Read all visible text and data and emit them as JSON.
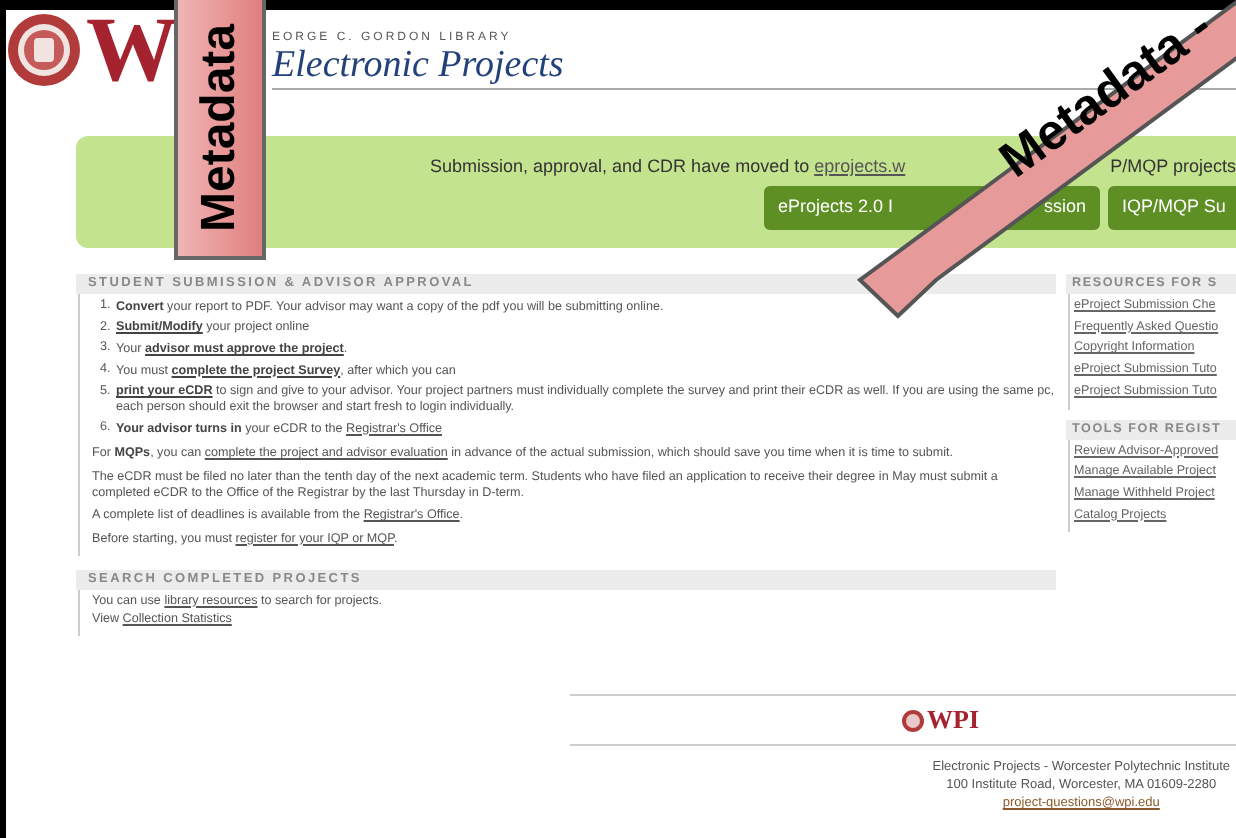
{
  "header": {
    "logo_letter": "W",
    "library": "EORGE C. GORDON LIBRARY",
    "title": "Electronic Projects"
  },
  "notice": {
    "parts": [
      {
        "kind": "text",
        "text": "Submission, approval, and CDR have moved to "
      },
      {
        "kind": "link",
        "text": "eprojects.w"
      }
    ],
    "trailing": "P/MQP projects",
    "buttons": [
      {
        "start": "eProjects 2.0 I",
        "end": "ssion"
      },
      {
        "start": "IQP/MQP Su"
      }
    ]
  },
  "sections": [
    {
      "title": "STUDENT SUBMISSION & ADVISOR APPROVAL",
      "steps": [
        {
          "number": "1.",
          "parts": [
            {
              "kind": "bold",
              "text": "Convert"
            },
            {
              "kind": "text",
              "text": " your report to PDF. Your advisor may want a copy of the pdf you will be submitting online."
            }
          ]
        },
        {
          "number": "2.",
          "parts": [
            {
              "kind": "bold_link",
              "text": "Submit/Modify"
            },
            {
              "kind": "text",
              "text": " your project online"
            }
          ]
        },
        {
          "number": "3.",
          "parts": [
            {
              "kind": "text",
              "text": "Your "
            },
            {
              "kind": "bold_link",
              "text": "advisor must approve the project"
            },
            {
              "kind": "text",
              "text": "."
            }
          ]
        },
        {
          "number": "4.",
          "parts": [
            {
              "kind": "text",
              "text": "You must "
            },
            {
              "kind": "bold_link",
              "text": "complete the project Survey"
            },
            {
              "kind": "text",
              "text": ", after which you can"
            }
          ]
        },
        {
          "number": "5.",
          "parts": [
            {
              "kind": "bold_link",
              "text": "print your eCDR"
            },
            {
              "kind": "text",
              "text": " to sign and give to your advisor. Your project partners must individually complete the survey and print their eCDR as well. If you are using the same pc, each person should exit the browser and start fresh to login individually."
            }
          ]
        },
        {
          "number": "6.",
          "parts": [
            {
              "kind": "bold",
              "text": "Your advisor turns in"
            },
            {
              "kind": "text",
              "text": " your eCDR to the "
            },
            {
              "kind": "link",
              "text": "Registrar's Office"
            }
          ]
        }
      ],
      "paragraphs": [
        [
          {
            "kind": "text",
            "text": "For "
          },
          {
            "kind": "bold",
            "text": "MQPs"
          },
          {
            "kind": "text",
            "text": ", you can "
          },
          {
            "kind": "link",
            "text": "complete the project and advisor evaluation"
          },
          {
            "kind": "text",
            "text": " in advance of the actual submission, which should save you time when it is time to submit."
          }
        ],
        [
          {
            "kind": "text",
            "text": "The eCDR must be filed no later than the tenth day of the next academic term. Students who have filed an application to receive their degree in May must submit a completed eCDR to the Office of the Registrar by the last Thursday in D-term."
          }
        ],
        [
          {
            "kind": "text",
            "text": "A complete list of deadlines is available from the "
          },
          {
            "kind": "link",
            "text": "Registrar's Office"
          },
          {
            "kind": "text",
            "text": "."
          }
        ],
        [
          {
            "kind": "text",
            "text": "Before starting, you must "
          },
          {
            "kind": "link",
            "text": "register for your IQP or MQP"
          },
          {
            "kind": "text",
            "text": "."
          }
        ]
      ]
    },
    {
      "title": "SEARCH COMPLETED PROJECTS",
      "paragraphs": [
        [
          {
            "kind": "text",
            "text": "You can use "
          },
          {
            "kind": "link",
            "text": "library resources"
          },
          {
            "kind": "text",
            "text": " to search for projects."
          }
        ],
        [
          {
            "kind": "text",
            "text": "View "
          },
          {
            "kind": "link",
            "text": "Collection Statistics"
          }
        ]
      ]
    }
  ],
  "sidebar": [
    {
      "title": "RESOURCES FOR S",
      "links": [
        "eProject Submission Che",
        "Frequently Asked Questio",
        "Copyright Information",
        "eProject Submission Tuto",
        "eProject Submission Tuto"
      ]
    },
    {
      "title": "TOOLS FOR REGIST",
      "links": [
        "Review Advisor-Approved",
        "Manage Available Project",
        "Manage Withheld Project",
        "Catalog Projects"
      ]
    }
  ],
  "footer": {
    "logo": "WPI",
    "lines": [
      "Electronic Projects - Worcester Polytechnic Institute",
      "100 Institute Road, Worcester, MA 01609-2280"
    ],
    "email": "project-questions@wpi.edu"
  },
  "overlays": [
    {
      "kind": "vertical",
      "text": "Metadata"
    },
    {
      "kind": "diagonal",
      "text": "Metadata -"
    }
  ]
}
